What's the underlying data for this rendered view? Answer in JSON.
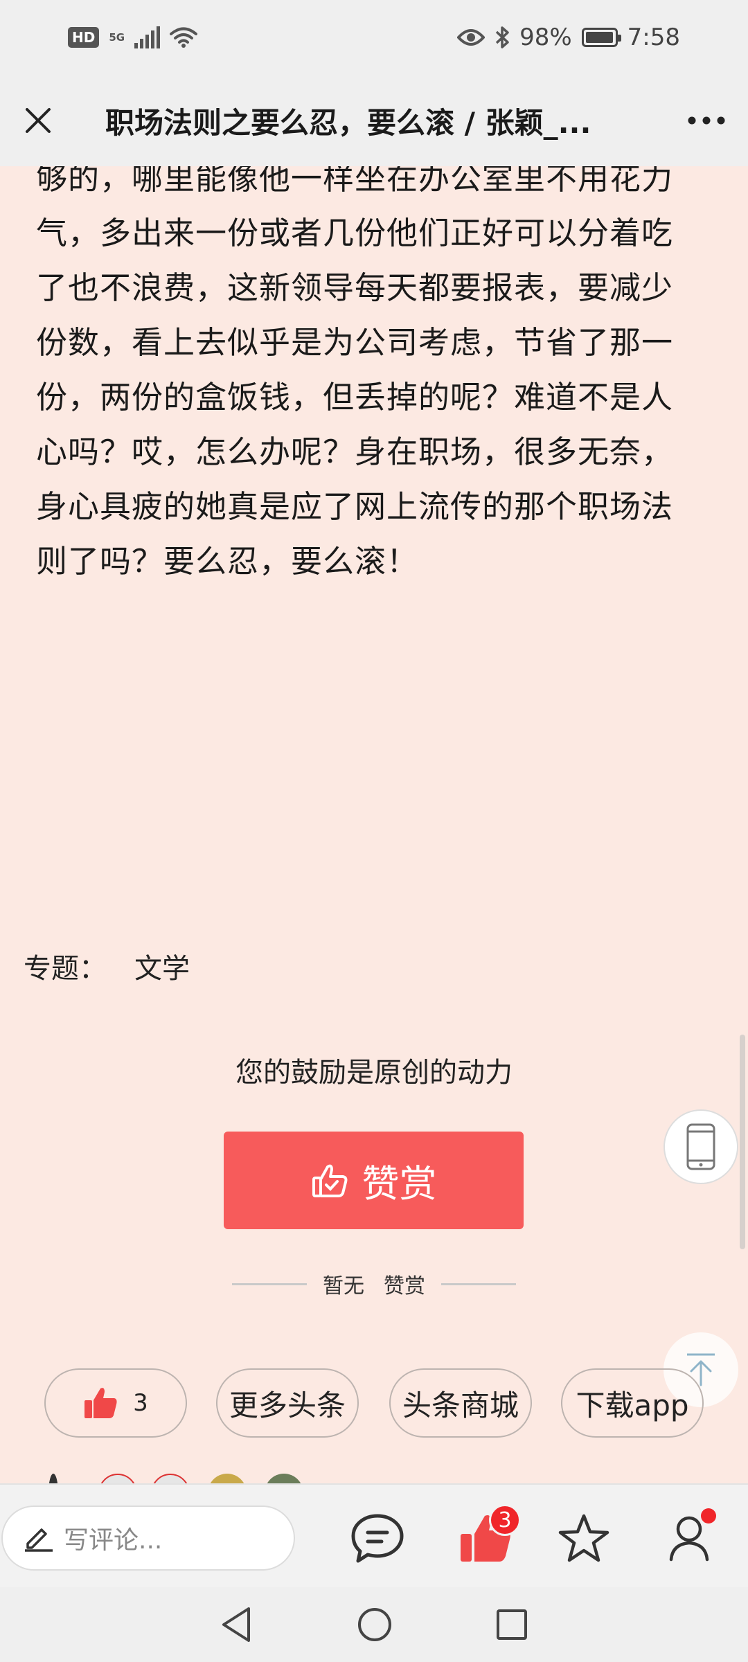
{
  "status_bar": {
    "hd": "HD",
    "network": "5G",
    "battery_percent": "98%",
    "time": "7:58"
  },
  "header": {
    "title": "职场法则之要么忍，要么滚 / 张颖_..."
  },
  "article": {
    "lines": [
      "够的，哪里能像他一样坐在办公室里不用花力",
      "气，多出来一份或者几份他们正好可以分着吃",
      "了也不浪费，这新领导每天都要报表，要减少",
      "份数，看上去似乎是为公司考虑，节省了那一",
      "份，两份的盒饭钱，但丢掉的呢？难道不是人",
      "心吗？哎，怎么办呢？身在职场，很多无奈，",
      "身心具疲的她真是应了网上流传的那个职场法",
      "则了吗？要么忍，要么滚！"
    ]
  },
  "topic": {
    "label": "专题：",
    "value": "文学"
  },
  "reward": {
    "encourage_text": "您的鼓励是原创的动力",
    "button_label": "赞赏",
    "no_reward_left": "暂无",
    "no_reward_right": "赞赏"
  },
  "actions": {
    "like_count": "3",
    "more_headlines": "更多头条",
    "mall": "头条商城",
    "download_app": "下载app"
  },
  "bottom_bar": {
    "comment_placeholder": "写评论...",
    "like_badge": "3"
  },
  "colors": {
    "page_bg": "#fce9e2",
    "accent_red": "#f75b5b",
    "badge_red": "#f0262a"
  },
  "icons": {
    "close": "close-icon",
    "more": "more-dots-icon",
    "phone": "phone-icon",
    "back_to_top": "arrow-up-icon",
    "comment": "comment-bubble-icon",
    "like": "thumbs-up-icon",
    "star": "star-icon",
    "user": "user-icon"
  }
}
